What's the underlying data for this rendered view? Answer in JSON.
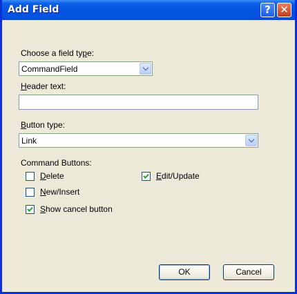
{
  "window": {
    "title": "Add Field"
  },
  "titlebar": {
    "help_icon": "?",
    "close_icon": "✕"
  },
  "field_type": {
    "label": "Choose a field type:",
    "selected": "CommandField"
  },
  "header_text": {
    "label": "Header text:",
    "value": ""
  },
  "button_type": {
    "label": "Button type:",
    "selected": "Link"
  },
  "command_buttons": {
    "label": "Command Buttons:",
    "delete": {
      "label": "Delete",
      "checked": false
    },
    "new_insert": {
      "label": "New/Insert",
      "checked": false
    },
    "show_cancel": {
      "label": "Show cancel button",
      "checked": true
    },
    "edit_update": {
      "label": "Edit/Update",
      "checked": true
    }
  },
  "buttons": {
    "ok": "OK",
    "cancel": "Cancel"
  },
  "colors": {
    "titlebar": "#0353e0",
    "face": "#ece9d8",
    "check": "#21a121"
  }
}
